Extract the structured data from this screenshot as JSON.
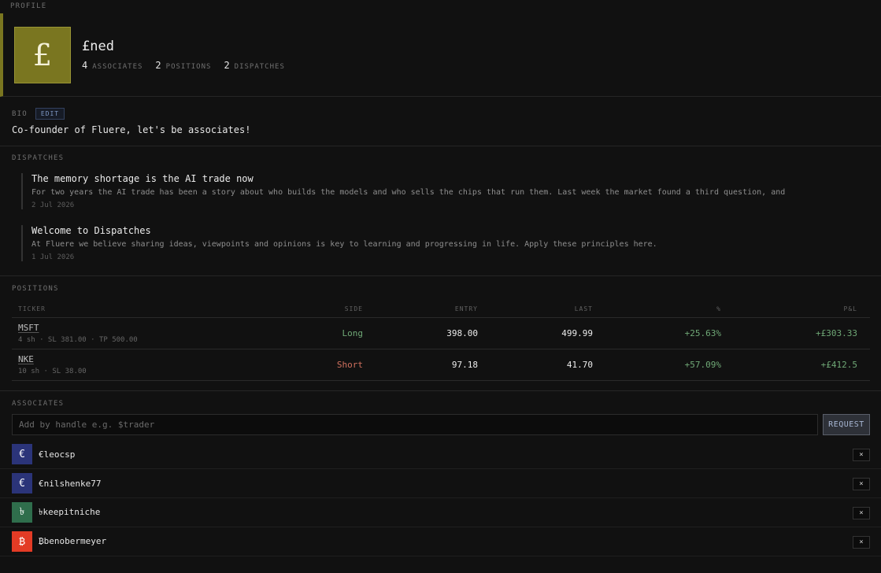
{
  "profile": {
    "section_label": "PROFILE",
    "avatar_glyph": "£",
    "handle": "£ned",
    "stats": [
      {
        "num": "4",
        "label": "ASSOCIATES"
      },
      {
        "num": "2",
        "label": "POSITIONS"
      },
      {
        "num": "2",
        "label": "DISPATCHES"
      }
    ],
    "accent_color": "#7a7620"
  },
  "bio": {
    "label": "BIO",
    "edit_label": "EDIT",
    "text": "Co-founder of Fluere, let's be associates!"
  },
  "dispatches": {
    "label": "DISPATCHES",
    "items": [
      {
        "title": "The memory shortage is the AI trade now",
        "body": "For two years the AI trade has been a story about who builds the models and who sells the chips that run them. Last week the market found a third question, and",
        "date": "2 Jul 2026"
      },
      {
        "title": "Welcome to Dispatches",
        "body": "At Fluere we believe sharing ideas, viewpoints and opinions is key to learning and progressing in life. Apply these principles here.",
        "date": "1 Jul 2026"
      }
    ]
  },
  "positions": {
    "label": "POSITIONS",
    "columns": [
      "TICKER",
      "SIDE",
      "ENTRY",
      "LAST",
      "%",
      "P&L"
    ],
    "rows": [
      {
        "ticker": "MSFT",
        "sub": "4 sh · SL 381.00 · TP 500.00",
        "side": "Long",
        "entry": "398.00",
        "last": "499.99",
        "pct": "+25.63%",
        "pnl": "+£303.33"
      },
      {
        "ticker": "NKE",
        "sub": "10 sh · SL 38.00",
        "side": "Short",
        "entry": "97.18",
        "last": "41.70",
        "pct": "+57.09%",
        "pnl": "+£412.5"
      }
    ]
  },
  "associates": {
    "label": "ASSOCIATES",
    "input_placeholder": "Add by handle e.g. $trader",
    "request_label": "REQUEST",
    "remove_label": "×",
    "items": [
      {
        "glyph": "€",
        "name": "€leocsp",
        "color": "#2b3479"
      },
      {
        "glyph": "€",
        "name": "€nilshenke77",
        "color": "#2b3479"
      },
      {
        "glyph": "৳",
        "name": "৳keepitniche",
        "color": "#2f6e4c"
      },
      {
        "glyph": "₿",
        "name": "₿benobermeyer",
        "color": "#e33b25"
      }
    ]
  }
}
